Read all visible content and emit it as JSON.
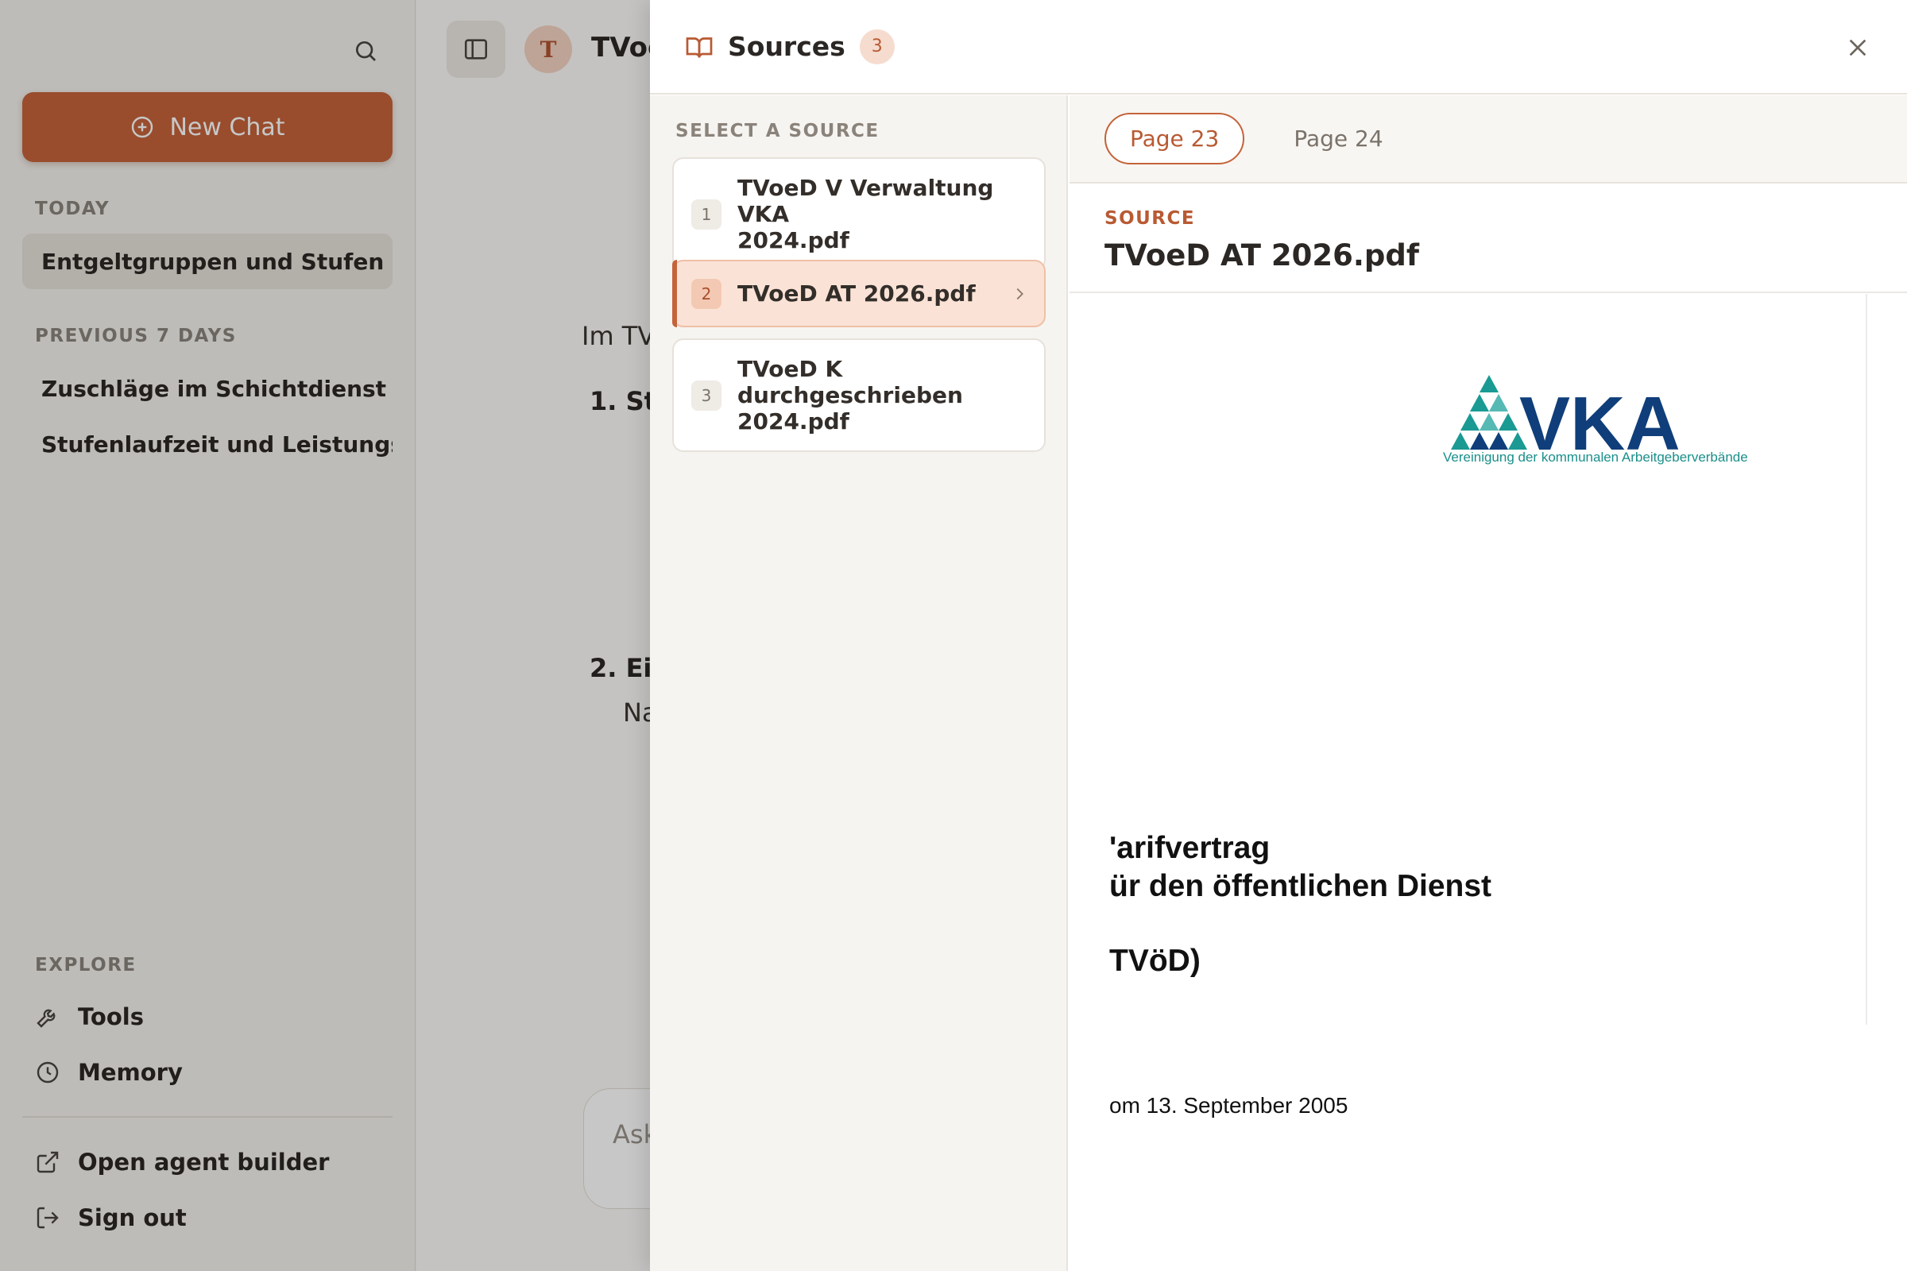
{
  "sidebar": {
    "new_chat_label": "New Chat",
    "sections": {
      "today": "TODAY",
      "previous": "PREVIOUS 7 DAYS",
      "explore": "EXPLORE"
    },
    "today_items": [
      "Entgeltgruppen und Stufen im ..."
    ],
    "previous_items": [
      "Zuschläge im Schichtdienst (P...",
      "Stufenlaufzeit und Leistungsz..."
    ],
    "explore_items": [
      "Tools",
      "Memory"
    ],
    "footer_items": [
      "Open agent builder",
      "Sign out"
    ]
  },
  "main": {
    "avatar_letter": "T",
    "title": "TVoe",
    "intro": "Im TV",
    "items": [
      {
        "num": "1.",
        "head": "St"
      },
      {
        "num": "2.",
        "head": "Ei",
        "sub": "Na"
      }
    ],
    "composer_placeholder": "Ask"
  },
  "sources_panel": {
    "title": "Sources",
    "count": "3",
    "list_label": "SELECT A SOURCE",
    "sources": [
      {
        "num": "1",
        "name_line1": "TVoeD V Verwaltung VKA",
        "name_line2": "2024.pdf"
      },
      {
        "num": "2",
        "name_line1": "TVoeD AT 2026.pdf",
        "name_line2": ""
      },
      {
        "num": "3",
        "name_line1": "TVoeD K durchgeschrieben",
        "name_line2": "2024.pdf"
      }
    ],
    "selected_index": 1,
    "pages": [
      "Page 23",
      "Page 24"
    ],
    "active_page": "Page 23",
    "source_kicker": "SOURCE",
    "source_name": "TVoeD AT 2026.pdf",
    "document": {
      "logo_text": "VKA",
      "logo_subtitle": "Vereinigung der kommunalen Arbeitgeberverbände",
      "line1": "'arifvertrag",
      "line2": "ür den öffentlichen Dienst",
      "line3": "TVöD)",
      "date_line": "om 13. September 2005"
    }
  },
  "colors": {
    "accent": "#c4633a",
    "teal": "#1a8f8a",
    "navy": "#0f3e7a"
  }
}
